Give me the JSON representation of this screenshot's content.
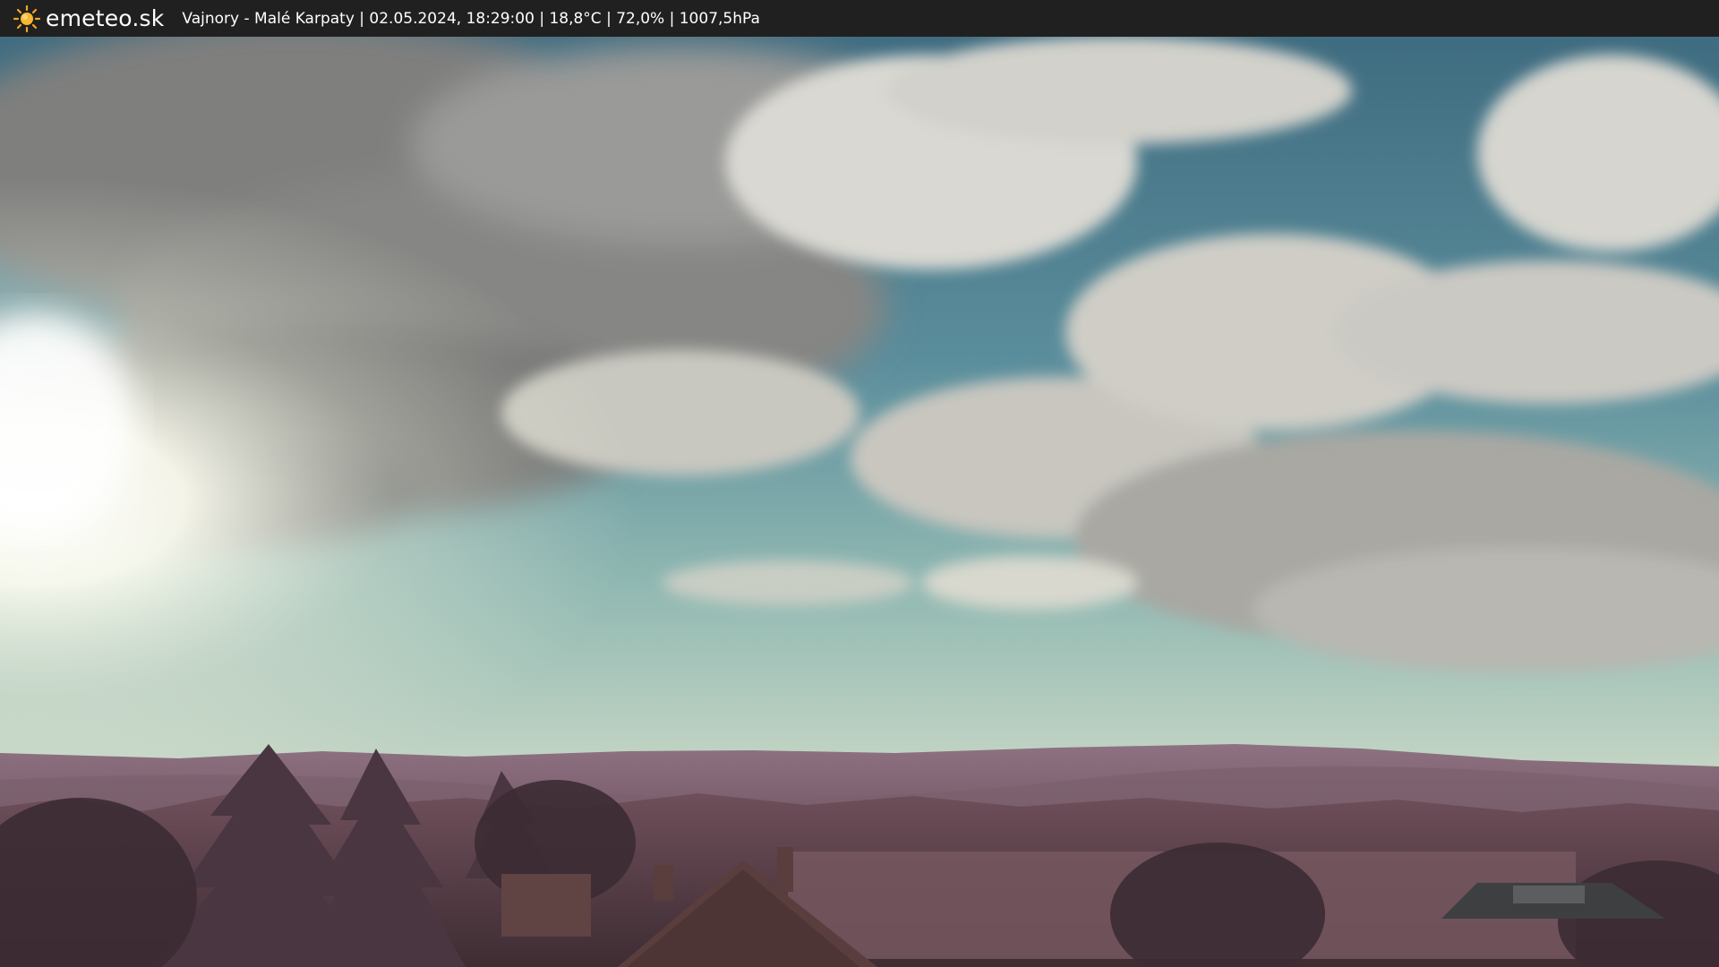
{
  "header": {
    "site_name": "emeteo.sk",
    "caption": "Vajnory - Malé Karpaty | 02.05.2024, 18:29:00 | 18,8°C | 72,0% | 1007,5hPa"
  },
  "logo": {
    "icon": "sun-icon",
    "color": "#f5a623"
  },
  "scene": {
    "description_icon": "webcam-landscape-image",
    "sky_color": "#5f8f9c",
    "vegetation_color": "#7a5663"
  }
}
